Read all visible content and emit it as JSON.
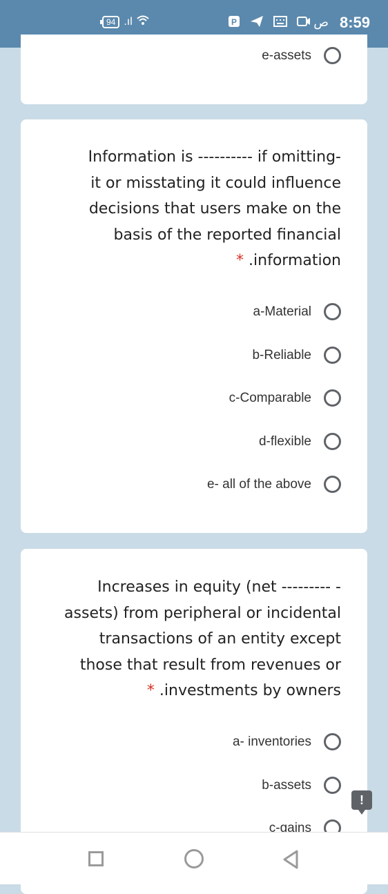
{
  "status_bar": {
    "time": "8:59",
    "ampm": "ص",
    "battery": "94"
  },
  "top_card": {
    "option_label": "e-assets"
  },
  "question1": {
    "lines": [
      "Information is ---------- if omitting-",
      "it or misstating it could influence",
      "decisions that users make on the",
      "basis of the reported financial"
    ],
    "last_line": ".information",
    "required_mark": "*",
    "options": [
      "a-Material",
      "b-Reliable",
      "c-Comparable",
      "d-flexible",
      "e- all of the above"
    ]
  },
  "question2": {
    "lines": [
      "Increases in equity (net --------- -",
      "assets) from peripheral or incidental",
      "transactions of an entity except",
      "those that result from revenues or"
    ],
    "last_line": ".investments by owners",
    "required_mark": "*",
    "options": [
      "a- inventories",
      "b-assets",
      "c-gains"
    ]
  },
  "report_button": {
    "label": "!"
  },
  "icons": {
    "status": [
      "battery-icon",
      "signal-icon",
      "wifi-icon",
      "parking-icon",
      "send-icon",
      "keyboard-icon",
      "camera-icon"
    ],
    "nav": [
      "recents-icon",
      "home-icon",
      "back-icon"
    ]
  },
  "colors": {
    "background": "#c9dbe6",
    "status_bar": "#5b89ad",
    "required": "#d93025",
    "radio": "#5f6368"
  }
}
